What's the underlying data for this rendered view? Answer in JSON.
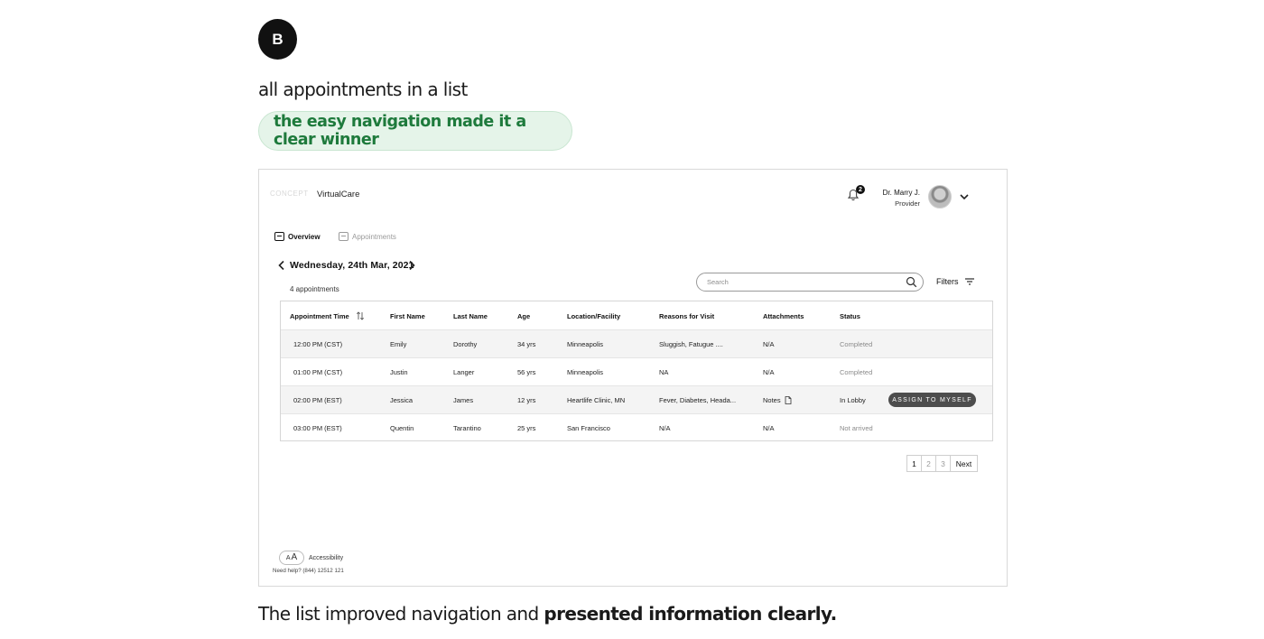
{
  "badge": "B",
  "headline": "all appointments in a list",
  "tagline": "the easy navigation made it a clear winner",
  "caption": {
    "regular": "The list improved navigation and ",
    "bold": "presented information clearly."
  },
  "screen": {
    "app_name": "VirtualCare",
    "logo_text": "CONCEPT",
    "notification_count": "2",
    "user": {
      "name": "Dr. Marry J.",
      "role": "Provider"
    },
    "tabs": [
      {
        "label": "Overview",
        "active": true
      },
      {
        "label": "Appointments",
        "active": false
      }
    ],
    "date_label": "Wednesday, 24th Mar, 2021",
    "appointment_count": "4 appointments",
    "search_placeholder": "Search",
    "filters_label": "Filters",
    "table": {
      "headers": [
        "Appointment Time",
        "First Name",
        "Last Name",
        "Age",
        "Location/Facility",
        "Reasons for Visit",
        "Attachments",
        "Status"
      ],
      "rows": [
        {
          "time": "12:00 PM  (CST)",
          "first": "Emily",
          "last": "Dorothy",
          "age": "34 yrs",
          "location": "Minneapolis",
          "reason": "Sluggish, Fatugue ....",
          "attachments": "N/A",
          "status": "Completed"
        },
        {
          "time": "01:00 PM (CST)",
          "first": "Justin",
          "last": "Langer",
          "age": "56 yrs",
          "location": "Minneapolis",
          "reason": "NA",
          "attachments": "N/A",
          "status": "Completed"
        },
        {
          "time": "02:00 PM (EST)",
          "first": "Jessica",
          "last": "James",
          "age": "12 yrs",
          "location": "Heartlife Clinic, MN",
          "reason": "Fever, Diabetes, Heada...",
          "attachments": "Notes",
          "status": "In Lobby"
        },
        {
          "time": "03:00 PM (EST)",
          "first": "Quentin",
          "last": "Tarantino",
          "age": "25 yrs",
          "location": "San Francisco",
          "reason": "N/A",
          "attachments": "N/A",
          "status": "Not arrived"
        }
      ],
      "assign_label": "ASSIGN TO MYSELF"
    },
    "pagination": {
      "pages": [
        "1",
        "2",
        "3"
      ],
      "current": "1",
      "next_label": "Next"
    },
    "accessibility": {
      "small": "A",
      "large": "A",
      "label": "Accessibility"
    },
    "help_text": "Need help?  (844) 12512 121"
  },
  "colors": {
    "tagline_bg": "#e5f4e9",
    "tagline_text": "#1e7a3c",
    "badge_bg": "#111111",
    "assign_button_bg": "#4d4d4d",
    "row_highlight": "#f4f4f4"
  }
}
